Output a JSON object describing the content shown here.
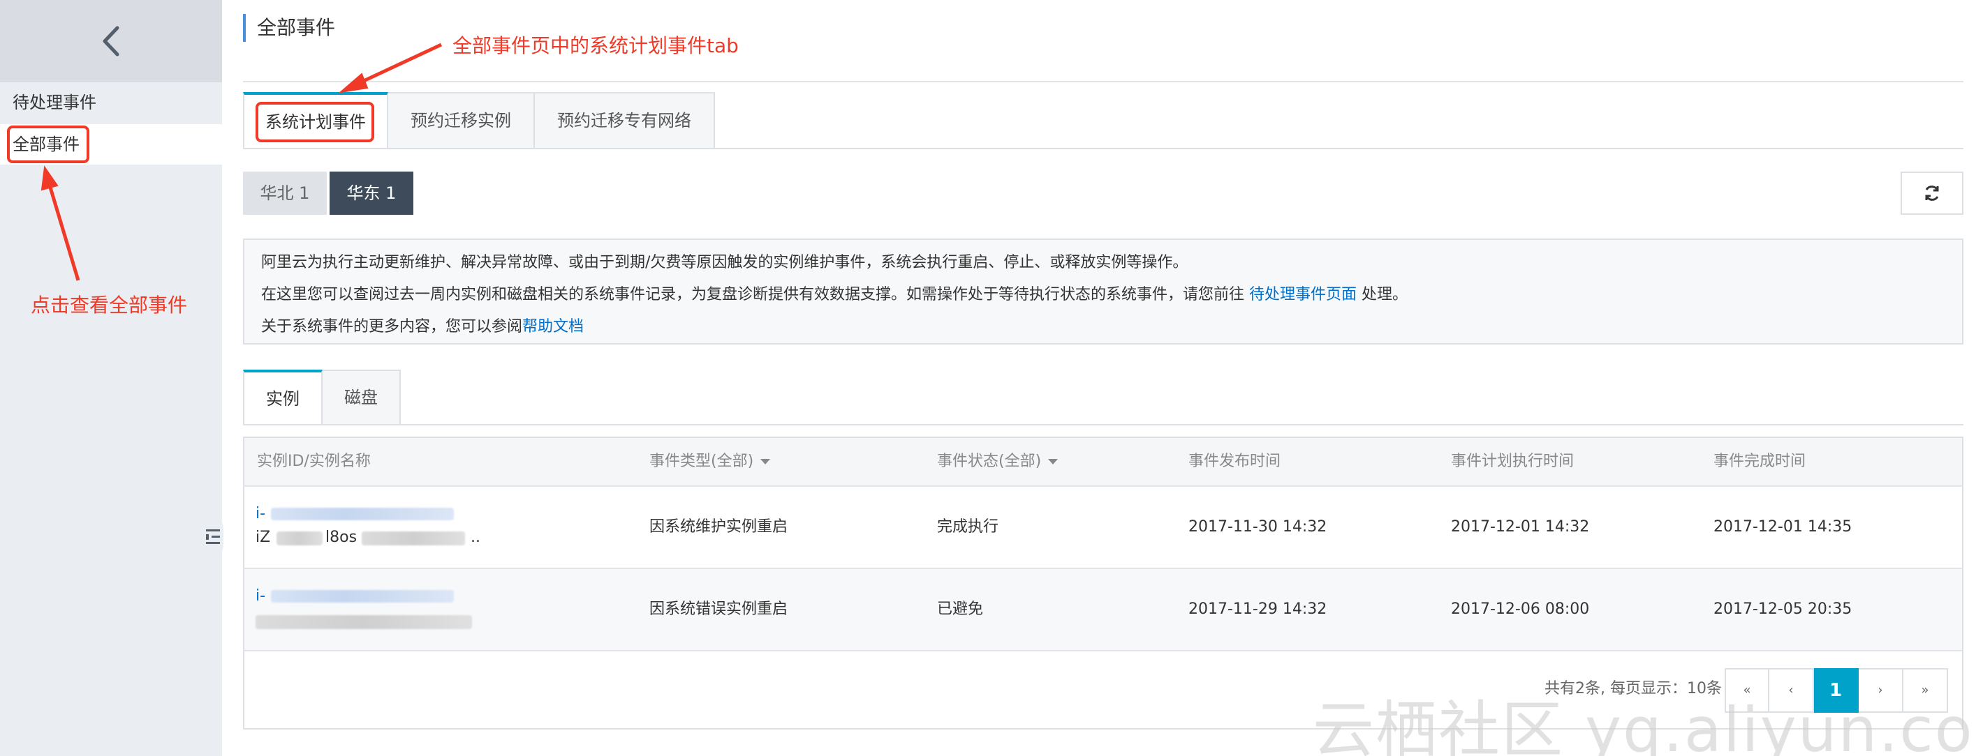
{
  "sidebar": {
    "items": [
      {
        "label": "待处理事件"
      },
      {
        "label": "全部事件"
      }
    ]
  },
  "page": {
    "title": "全部事件"
  },
  "top_tabs": [
    {
      "label": "系统计划事件"
    },
    {
      "label": "预约迁移实例"
    },
    {
      "label": "预约迁移专有网络"
    }
  ],
  "regions": [
    {
      "label": "华北 1"
    },
    {
      "label": "华东 1"
    }
  ],
  "notice": {
    "line1": "阿里云为执行主动更新维护、解决异常故障、或由于到期/欠费等原因触发的实例维护事件，系统会执行重启、停止、或释放实例等操作。",
    "line2_pre": "在这里您可以查阅过去一周内实例和磁盘相关的系统事件记录，为复盘诊断提供有效数据支撑。如需操作处于等待执行状态的系统事件，请您前往 ",
    "line2_link": "待处理事件页面",
    "line2_post": " 处理。",
    "line3_pre": "关于系统事件的更多内容，您可以参阅",
    "line3_link": "帮助文档"
  },
  "sub_tabs": [
    {
      "label": "实例"
    },
    {
      "label": "磁盘"
    }
  ],
  "table": {
    "headers": {
      "id": "实例ID/实例名称",
      "type": "事件类型(全部)",
      "status": "事件状态(全部)",
      "publish": "事件发布时间",
      "plan": "事件计划执行时间",
      "finish": "事件完成时间"
    },
    "rows": [
      {
        "id_prefix": "i-",
        "name_prefix": "iZ",
        "name_mid": "l8os",
        "name_suffix": "..",
        "type": "因系统维护实例重启",
        "status": "完成执行",
        "publish": "2017-11-30 14:32",
        "plan": "2017-12-01 14:32",
        "finish": "2017-12-01 14:35"
      },
      {
        "id_prefix": "i-",
        "type": "因系统错误实例重启",
        "status": "已避免",
        "publish": "2017-11-29 14:32",
        "plan": "2017-12-06 08:00",
        "finish": "2017-12-05 20:35"
      }
    ]
  },
  "pagination": {
    "summary": "共有2条, 每页显示：10条",
    "first": "«",
    "prev": "‹",
    "current": "1",
    "next": "›",
    "last": "»"
  },
  "annotations": {
    "tab_note": "全部事件页中的系统计划事件tab",
    "sidebar_note": "点击查看全部事件",
    "color": "#f03a27"
  },
  "watermark": "云栖社区 yq.aliyun.com",
  "colors": {
    "accent": "#00a2ca",
    "link": "#0070cc",
    "region_active": "#3e4b5b"
  },
  "icons": {
    "back": "chevron-left-icon",
    "refresh": "refresh-icon",
    "collapse": "sidebar-toggle-icon",
    "sort": "caret-down-icon"
  }
}
